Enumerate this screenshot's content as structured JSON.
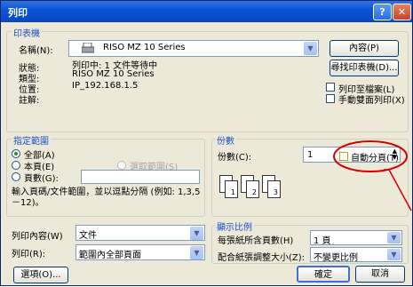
{
  "window": {
    "title": "列印",
    "help": "?",
    "close": "✕"
  },
  "printer": {
    "group_label": "印表機",
    "name_label": "名稱(N):",
    "name_value": "RISO MZ 10 Series",
    "properties_button": "內容(P)",
    "status_label": "狀態:",
    "status_value": "列印中: 1 文件等待中",
    "type_label": "類型:",
    "type_value": "RISO MZ 10 Series",
    "where_label": "位置:",
    "where_value": "IP_192.168.1.5",
    "comment_label": "註解:",
    "find_button": "尋找印表機(D)...",
    "print_to_file": "列印至檔案(L)",
    "manual_duplex": "手動雙面列印(X)"
  },
  "range": {
    "group_label": "指定範圍",
    "all": "全部(A)",
    "current": "本頁(E)",
    "selection": "選取範圍(S)",
    "pages": "頁數(G):",
    "hint": "輸入頁碼/文件範圍，並以逗點分隔 (例如: 1,3,5－12)。"
  },
  "copies": {
    "group_label": "份數",
    "copies_label": "份數(C):",
    "copies_value": "1",
    "collate": "自動分頁(T)",
    "pages": [
      "1",
      "2",
      "3"
    ]
  },
  "print_what": {
    "label": "列印內容(W)",
    "value": "文件",
    "print_label": "列印(R):",
    "print_value": "範圍內全部頁面"
  },
  "zoom": {
    "group_label": "顯示比例",
    "pages_per_sheet_label": "每張紙所含頁數(H)",
    "pages_per_sheet_value": "1 頁",
    "scale_label": "配合紙張調整大小(Z):",
    "scale_value": "不變更比例"
  },
  "buttons": {
    "options": "選項(O)...",
    "ok": "確定",
    "cancel": "取消"
  },
  "annotation_color": "#d40000"
}
